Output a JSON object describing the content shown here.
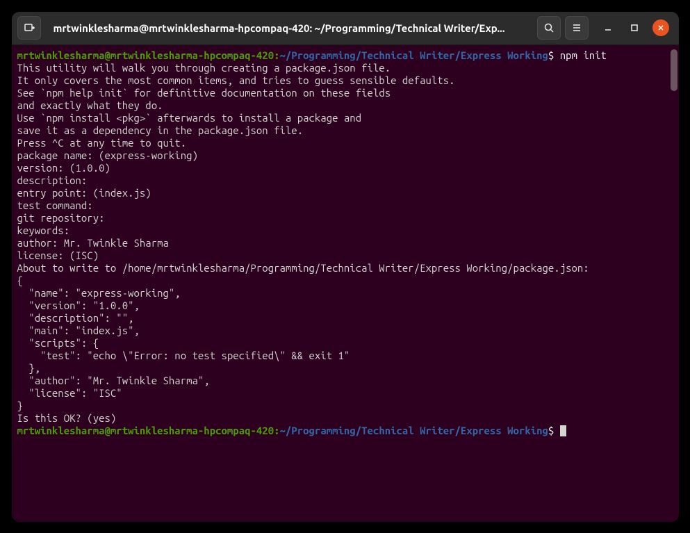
{
  "titlebar": {
    "title": "mrtwinklesharma@mrtwinklesharma-hpcompaq-420: ~/Programming/Technical Writer/Exp..."
  },
  "prompt1": {
    "user": "mrtwinklesharma@mrtwinklesharma-hpcompaq-420",
    "path": "~/Programming/Technical Writer/Express Working",
    "dollar": "$",
    "command": "npm init"
  },
  "output": {
    "lines": [
      "This utility will walk you through creating a package.json file.",
      "It only covers the most common items, and tries to guess sensible defaults.",
      "",
      "See `npm help init` for definitive documentation on these fields",
      "and exactly what they do.",
      "",
      "Use `npm install <pkg>` afterwards to install a package and",
      "save it as a dependency in the package.json file.",
      "",
      "Press ^C at any time to quit.",
      "package name: (express-working) ",
      "version: (1.0.0) ",
      "description: ",
      "entry point: (index.js) ",
      "test command: ",
      "git repository: ",
      "keywords: ",
      "author: Mr. Twinkle Sharma",
      "license: (ISC) ",
      "About to write to /home/mrtwinklesharma/Programming/Technical Writer/Express Working/package.json:",
      "",
      "{",
      "  \"name\": \"express-working\",",
      "  \"version\": \"1.0.0\",",
      "  \"description\": \"\",",
      "  \"main\": \"index.js\",",
      "  \"scripts\": {",
      "    \"test\": \"echo \\\"Error: no test specified\\\" && exit 1\"",
      "  },",
      "  \"author\": \"Mr. Twinkle Sharma\",",
      "  \"license\": \"ISC\"",
      "}",
      "",
      "",
      "Is this OK? (yes) "
    ]
  },
  "prompt2": {
    "user": "mrtwinklesharma@mrtwinklesharma-hpcompaq-420",
    "path": "~/Programming/Technical Writer/Express Working",
    "dollar": "$"
  }
}
